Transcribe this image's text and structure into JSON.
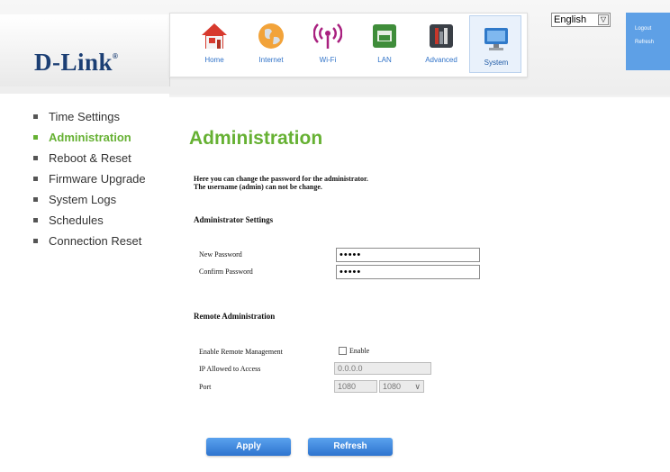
{
  "brand": {
    "name": "D-Link",
    "mark": "®"
  },
  "nav": {
    "items": [
      {
        "label": "Home",
        "icon": "home-icon"
      },
      {
        "label": "Internet",
        "icon": "internet-globe-icon"
      },
      {
        "label": "Wi-Fi",
        "icon": "wifi-icon"
      },
      {
        "label": "LAN",
        "icon": "lan-port-icon"
      },
      {
        "label": "Advanced",
        "icon": "advanced-tools-icon"
      },
      {
        "label": "System",
        "icon": "system-monitor-icon"
      }
    ],
    "active": "System"
  },
  "language": {
    "selected": "English",
    "arrow": "▽"
  },
  "header_links": {
    "logout": "Logout",
    "refresh": "Refresh"
  },
  "sidebar": {
    "items": [
      {
        "label": "Time Settings"
      },
      {
        "label": "Administration"
      },
      {
        "label": "Reboot & Reset"
      },
      {
        "label": "Firmware Upgrade"
      },
      {
        "label": "System Logs"
      },
      {
        "label": "Schedules"
      },
      {
        "label": "Connection Reset"
      }
    ],
    "active": "Administration"
  },
  "main": {
    "title": "Administration",
    "description_line1": "Here you can change the password for the administrator.",
    "description_line2": "The username (admin) can not be change.",
    "admin_section": {
      "heading": "Administrator Settings",
      "new_password_label": "New Password",
      "new_password_value": "•••••",
      "confirm_password_label": "Confirm Password",
      "confirm_password_value": "•••••"
    },
    "remote_section": {
      "heading": "Remote Administration",
      "enable_label": "Enable Remote Management",
      "enable_checkbox_label": "Enable",
      "enable_checked": false,
      "ip_label": "IP Allowed to Access",
      "ip_value": "0.0.0.0",
      "port_label": "Port",
      "port_value": "1080",
      "port_select_value": "1080",
      "port_chevron": "∨"
    },
    "buttons": {
      "apply": "Apply",
      "refresh": "Refresh"
    }
  },
  "colors": {
    "accent_green": "#66b133",
    "accent_blue": "#2e74cf",
    "brand_navy": "#1c3f74"
  }
}
